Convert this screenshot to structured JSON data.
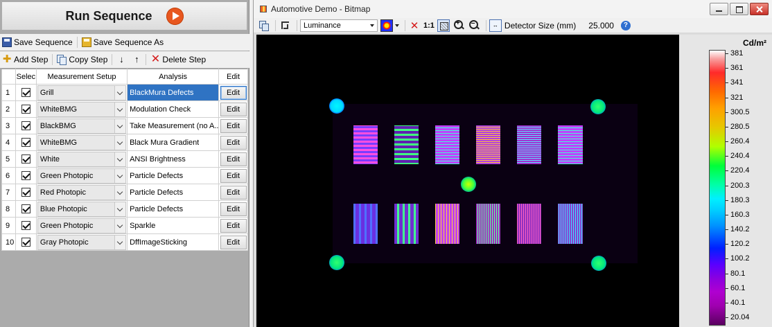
{
  "left_panel": {
    "run_sequence_label": "Run Sequence",
    "save_sequence_label": "Save Sequence",
    "save_sequence_as_label": "Save Sequence As",
    "add_step_label": "Add Step",
    "copy_step_label": "Copy Step",
    "delete_step_label": "Delete Step",
    "columns": [
      "Selec",
      "Measurement Setup",
      "Analysis",
      "Edit"
    ],
    "edit_label": "Edit",
    "selected_row": 1,
    "steps": [
      {
        "num": "1",
        "checked": true,
        "setup": "Grill",
        "analysis": "BlackMura Defects"
      },
      {
        "num": "2",
        "checked": true,
        "setup": "WhiteBMG",
        "analysis": "Modulation Check"
      },
      {
        "num": "3",
        "checked": true,
        "setup": "BlackBMG",
        "analysis": "Take Measurement (no A..."
      },
      {
        "num": "4",
        "checked": true,
        "setup": "WhiteBMG",
        "analysis": "Black Mura Gradient"
      },
      {
        "num": "5",
        "checked": true,
        "setup": "White",
        "analysis": "ANSI Brightness"
      },
      {
        "num": "6",
        "checked": true,
        "setup": "Green Photopic",
        "analysis": "Particle Defects"
      },
      {
        "num": "7",
        "checked": true,
        "setup": "Red Photopic",
        "analysis": "Particle Defects"
      },
      {
        "num": "8",
        "checked": true,
        "setup": "Blue Photopic",
        "analysis": "Particle Defects"
      },
      {
        "num": "9",
        "checked": true,
        "setup": "Green Photopic",
        "analysis": "Sparkle"
      },
      {
        "num": "10",
        "checked": true,
        "setup": "Gray Photopic",
        "analysis": "DffImageSticking"
      }
    ]
  },
  "bitmap_window": {
    "title": "Automotive Demo - Bitmap",
    "display_mode": "Luminance",
    "zoom_1_1_label": "1:1",
    "detector_label": "Detector Size (mm)",
    "detector_value": "25.000",
    "scale_unit": "Cd/m²",
    "scale_ticks": [
      "381",
      "361",
      "341",
      "321",
      "300.5",
      "280.5",
      "260.4",
      "240.4",
      "220.4",
      "200.3",
      "180.3",
      "160.3",
      "140.2",
      "120.2",
      "100.2",
      "80.1",
      "60.1",
      "40.1",
      "20.04"
    ],
    "icons": {
      "copy": "copy-image-icon",
      "crop": "crop-icon",
      "palette": "palette-icon",
      "clear": "clear-x-icon",
      "fit": "fit-to-window-icon",
      "zoom_in": "zoom-in-icon",
      "zoom_out": "zoom-out-icon",
      "detector": "detector-size-icon",
      "help": "help-icon"
    }
  },
  "colors": {
    "run_icon": "#e8571f",
    "selection": "#2f73c3"
  }
}
